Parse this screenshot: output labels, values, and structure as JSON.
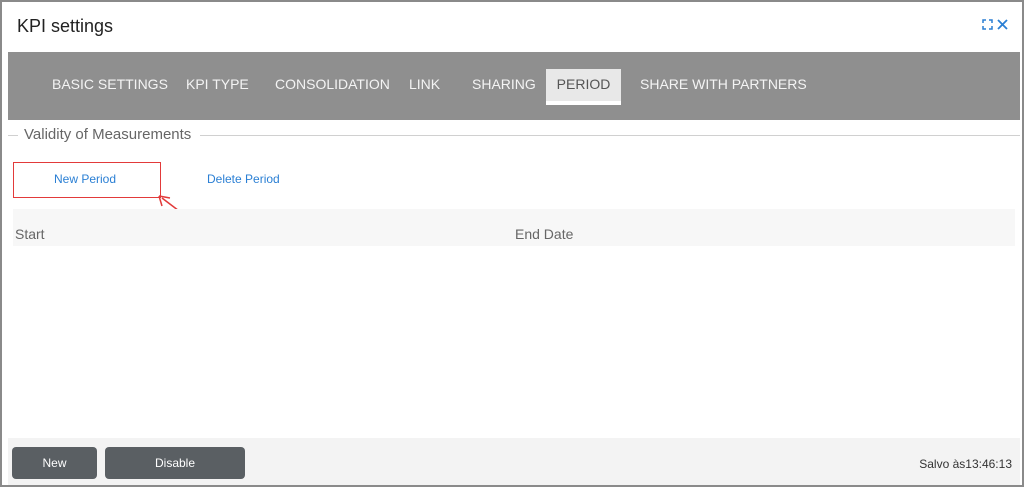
{
  "window": {
    "title": "KPI settings"
  },
  "tabs": [
    {
      "label": "BASIC SETTINGS"
    },
    {
      "label": "KPI TYPE"
    },
    {
      "label": "CONSOLIDATION"
    },
    {
      "label": "LINK"
    },
    {
      "label": "SHARING"
    },
    {
      "label": "PERIOD",
      "active": true
    },
    {
      "label": "SHARE WITH PARTNERS"
    }
  ],
  "section": {
    "legend": "Validity of Measurements"
  },
  "actions": {
    "new_period": "New Period",
    "delete_period": "Delete Period"
  },
  "table": {
    "columns": [
      "Start",
      "End Date"
    ],
    "rows": []
  },
  "footer": {
    "new_label": "New",
    "disable_label": "Disable",
    "status": "Salvo às13:46:13"
  },
  "icons": {
    "expand": "expand-icon",
    "close": "close-icon"
  },
  "colors": {
    "accent": "#2a7fd4",
    "tabbar": "#8f8f8f",
    "annotation": "#e23a3a"
  }
}
